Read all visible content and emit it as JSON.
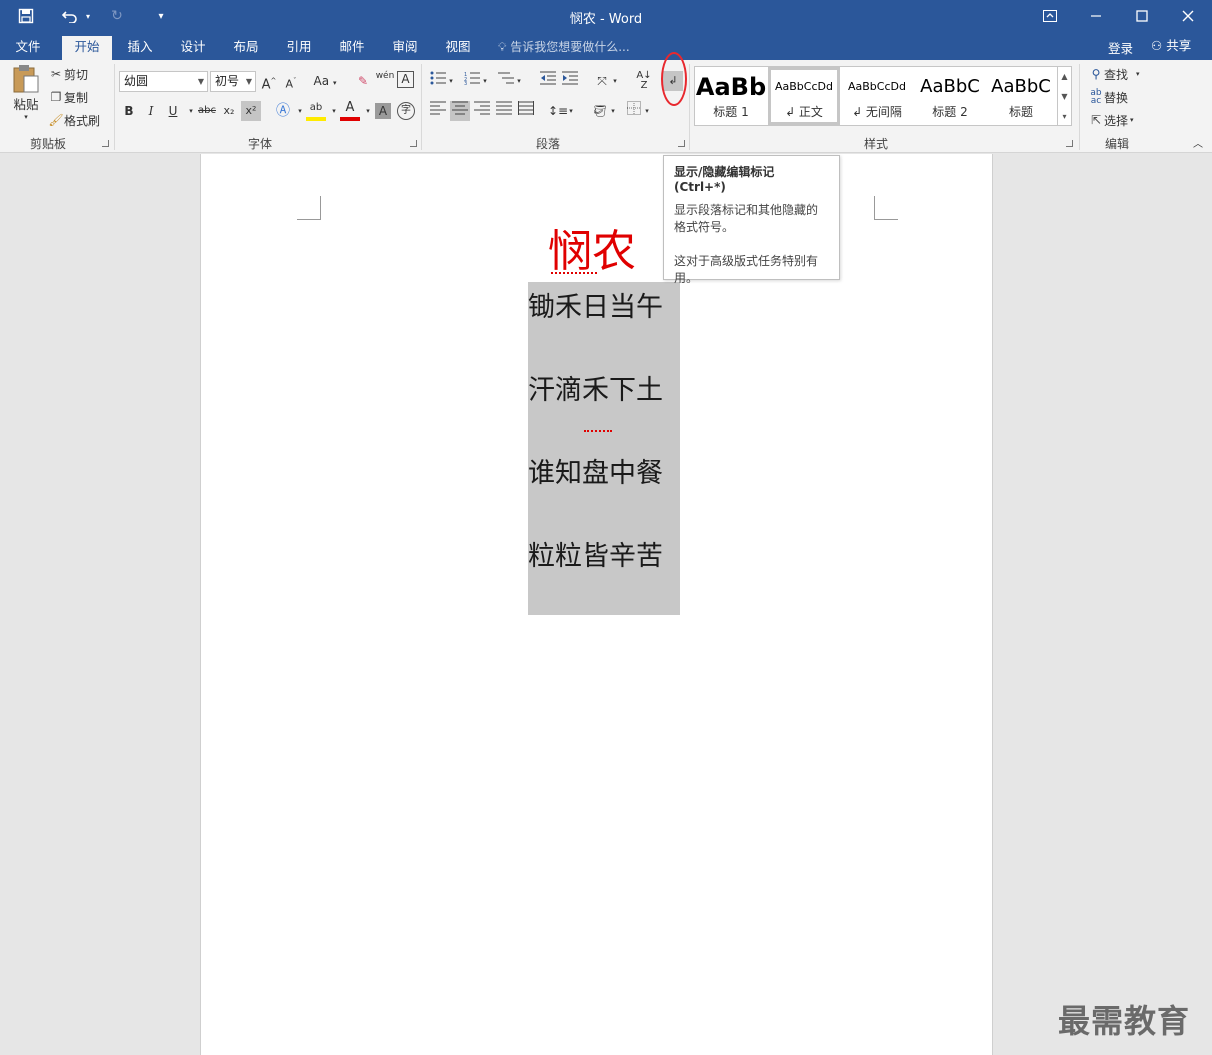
{
  "window": {
    "title": "悯农 - Word",
    "quick_access": [
      "save-icon",
      "undo-icon",
      "redo-icon",
      "customize-icon"
    ],
    "controls": [
      "ribbon-display-icon",
      "minimize-icon",
      "maximize-icon",
      "close-icon"
    ]
  },
  "tabs": [
    "文件",
    "开始",
    "插入",
    "设计",
    "布局",
    "引用",
    "邮件",
    "审阅",
    "视图"
  ],
  "active_tab": "开始",
  "tell_me": "告诉我您想要做什么...",
  "account": {
    "login": "登录",
    "share": "共享"
  },
  "clipboard": {
    "paste": "粘贴",
    "cut": "剪切",
    "copy": "复制",
    "format_painter": "格式刷",
    "label": "剪贴板"
  },
  "font": {
    "name": "幼圆",
    "size": "初号",
    "label": "字体",
    "buttons": {
      "grow": "A",
      "shrink": "A",
      "case": "Aa",
      "bold": "B",
      "italic": "I",
      "underline": "U",
      "strike": "abc",
      "subscript": "x₂",
      "superscript": "x²",
      "pinyin": "wén",
      "char_border": "A",
      "highlight": "ab",
      "font_color": "A",
      "shade": "A",
      "enclose": "字"
    }
  },
  "paragraph": {
    "label": "段落"
  },
  "styles": {
    "label": "样式",
    "items": [
      {
        "sample": "AaBb",
        "name": "标题 1"
      },
      {
        "sample": "AaBbCcDd",
        "name": "↲ 正文"
      },
      {
        "sample": "AaBbCcDd",
        "name": "↲ 无间隔"
      },
      {
        "sample": "AaBbC",
        "name": "标题 2"
      },
      {
        "sample": "AaBbC",
        "name": "标题"
      }
    ]
  },
  "editing": {
    "find": "查找",
    "replace": "替换",
    "select": "选择",
    "label": "编辑"
  },
  "tooltip": {
    "title": "显示/隐藏编辑标记 (Ctrl+*)",
    "line1": "显示段落标记和其他隐藏的格式符号。",
    "line2": "这对于高级版式任务特别有用。"
  },
  "document": {
    "title": "悯农",
    "lines": [
      "锄禾日当午",
      "汗滴禾下土",
      "谁知盘中餐",
      "粒粒皆辛苦"
    ]
  },
  "watermark": "最需教育",
  "colors": {
    "brand": "#2b579a",
    "title_red": "#e00000",
    "selection": "#c8c8c8",
    "annotation": "#e8282e"
  }
}
